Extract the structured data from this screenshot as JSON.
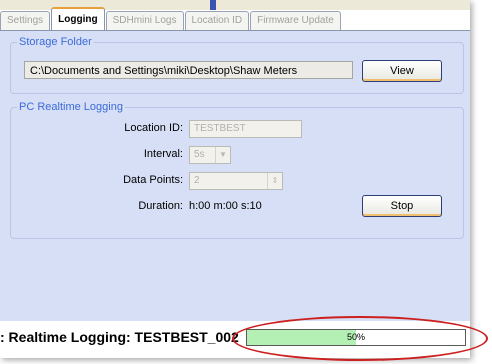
{
  "tabs": [
    {
      "label": "Settings",
      "active": false
    },
    {
      "label": "Logging",
      "active": true
    },
    {
      "label": "SDHmini Logs",
      "active": false
    },
    {
      "label": "Location ID",
      "active": false
    },
    {
      "label": "Firmware Update",
      "active": false
    }
  ],
  "storage": {
    "title": "Storage Folder",
    "path": "C:\\Documents and Settings\\miki\\Desktop\\Shaw Meters",
    "view_label": "View"
  },
  "realtime": {
    "title": "PC Realtime Logging",
    "location_label": "Location ID:",
    "location_value": "TESTBEST",
    "interval_label": "Interval:",
    "interval_value": "5s",
    "datapoints_label": "Data Points:",
    "datapoints_value": "2",
    "duration_label": "Duration:",
    "duration_value": "h:00 m:00 s:10",
    "stop_label": "Stop"
  },
  "status": {
    "text": ": Realtime Logging: TESTBEST_002",
    "progress_percent": 50,
    "progress_label": "50%"
  },
  "colors": {
    "panel": "#d6dff5",
    "group_title": "#3d6bd9",
    "progress_fill": "#b4f0b4",
    "highlight": "#cc2020"
  }
}
